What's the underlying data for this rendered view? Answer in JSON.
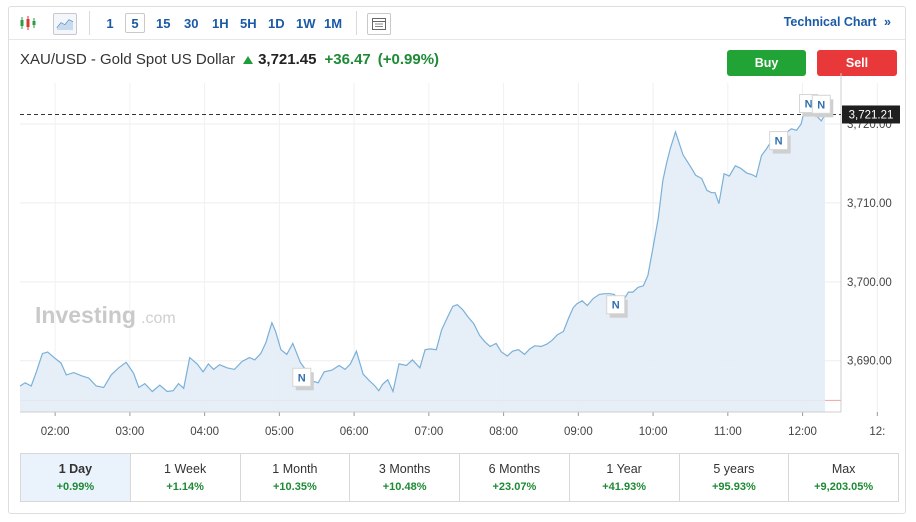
{
  "toolbar": {
    "timeframes": [
      "1",
      "5",
      "15",
      "30",
      "1H",
      "5H",
      "1D",
      "1W",
      "1M"
    ],
    "active_timeframe": "5",
    "technical_chart_label": "Technical Chart",
    "technical_chart_arrow": "»"
  },
  "instrument": {
    "title": "XAU/USD - Gold Spot US Dollar",
    "price": "3,721.45",
    "change": "+36.47",
    "change_pct": "(+0.99%)"
  },
  "actions": {
    "buy_label": "Buy",
    "sell_label": "Sell"
  },
  "watermark": {
    "brand": "Investing",
    "suffix": ".com"
  },
  "colors": {
    "up": "#1e8a35",
    "line": "#7ab0d8",
    "area": "#e3edf6",
    "buy": "#22a335",
    "sell": "#e8383a",
    "link": "#1a5aa6"
  },
  "chart_data": {
    "type": "area",
    "current_price_label": "3,721.21",
    "current_price": 3721.21,
    "previous_close": 3684.98,
    "x_ticks": [
      "02:00",
      "03:00",
      "04:00",
      "05:00",
      "06:00",
      "07:00",
      "08:00",
      "09:00",
      "10:00",
      "11:00",
      "12:00",
      "12:"
    ],
    "y_ticks": [
      "3,690.00",
      "3,700.00",
      "3,710.00",
      "3,720.00"
    ],
    "ylim": [
      3683.5,
      3725.2
    ],
    "xlim": [
      1.53,
      12.3
    ],
    "grid": true,
    "news_marker_label": "N",
    "news_markers": [
      {
        "t": 5.3,
        "y": 3687.9
      },
      {
        "t": 9.5,
        "y": 3697.1
      },
      {
        "t": 11.68,
        "y": 3717.9
      },
      {
        "t": 12.08,
        "y": 3722.6
      },
      {
        "t": 12.25,
        "y": 3722.5
      }
    ],
    "series": [
      {
        "x": [
          1.53,
          1.6,
          1.68,
          1.75,
          1.83,
          1.9,
          2.0,
          2.08,
          2.15,
          2.25,
          2.35,
          2.45,
          2.55,
          2.65,
          2.75,
          2.85,
          2.95,
          3.05,
          3.12,
          3.2,
          3.3,
          3.4,
          3.5,
          3.58,
          3.65,
          3.72,
          3.8,
          3.9,
          3.98,
          4.05,
          4.12,
          4.2,
          4.3,
          4.4,
          4.5,
          4.6,
          4.67,
          4.75,
          4.82,
          4.9,
          4.95,
          5.02,
          5.1,
          5.18,
          5.28,
          5.38,
          5.45,
          5.52,
          5.6,
          5.7,
          5.8,
          5.88,
          5.95,
          6.03,
          6.12,
          6.2,
          6.28,
          6.33,
          6.38,
          6.45,
          6.52,
          6.6,
          6.7,
          6.78,
          6.88,
          6.95,
          7.02,
          7.1,
          7.17,
          7.25,
          7.32,
          7.38,
          7.45,
          7.52,
          7.6,
          7.68,
          7.75,
          7.82,
          7.9,
          7.97,
          8.05,
          8.12,
          8.2,
          8.28,
          8.35,
          8.42,
          8.5,
          8.58,
          8.65,
          8.72,
          8.8,
          8.87,
          8.93,
          8.98,
          9.05,
          9.12,
          9.2,
          9.28,
          9.35,
          9.42,
          9.48,
          9.53,
          9.6,
          9.67,
          9.73,
          9.8,
          9.87,
          9.93,
          10.0,
          10.07,
          10.13,
          10.18,
          10.23,
          10.3,
          10.4,
          10.5,
          10.57,
          10.65,
          10.72,
          10.78,
          10.83,
          10.88,
          10.95,
          11.02,
          11.1,
          11.17,
          11.25,
          11.32,
          11.38,
          11.45,
          11.52,
          11.58,
          11.65,
          11.72,
          11.78,
          11.85,
          11.92,
          11.98,
          12.05,
          12.1,
          12.15,
          12.2,
          12.25,
          12.3
        ],
        "y": [
          3686.8,
          3687.2,
          3686.8,
          3688.6,
          3690.9,
          3691.1,
          3690.3,
          3689.7,
          3688.2,
          3688.5,
          3688.1,
          3687.8,
          3686.8,
          3686.6,
          3688.2,
          3689.1,
          3689.8,
          3688.4,
          3686.6,
          3687.1,
          3686.1,
          3686.9,
          3686.1,
          3686.2,
          3687.1,
          3686.5,
          3690.4,
          3689.6,
          3688.6,
          3689.6,
          3688.9,
          3689.5,
          3689.1,
          3688.9,
          3689.9,
          3690.4,
          3690.1,
          3690.9,
          3692.3,
          3694.8,
          3693.7,
          3691.4,
          3690.8,
          3692.2,
          3689.8,
          3688.5,
          3687.4,
          3687.2,
          3688.6,
          3688.8,
          3689.4,
          3688.9,
          3689.6,
          3691.2,
          3688.3,
          3687.5,
          3686.8,
          3686.2,
          3687.0,
          3687.6,
          3686.1,
          3689.6,
          3689.4,
          3690.1,
          3689.1,
          3691.4,
          3691.5,
          3691.4,
          3693.9,
          3695.5,
          3696.9,
          3697.1,
          3696.5,
          3695.6,
          3694.7,
          3693.2,
          3692.4,
          3691.8,
          3692.2,
          3691.1,
          3690.6,
          3691.2,
          3691.4,
          3690.8,
          3691.5,
          3691.9,
          3691.8,
          3692.1,
          3692.6,
          3693.3,
          3693.7,
          3695.4,
          3696.7,
          3697.2,
          3697.6,
          3697.0,
          3697.9,
          3698.4,
          3698.5,
          3698.5,
          3698.4,
          3697.8,
          3697.6,
          3698.7,
          3698.7,
          3699.3,
          3699.5,
          3700.8,
          3704.4,
          3708.1,
          3712.8,
          3715.0,
          3716.9,
          3719.0,
          3716.1,
          3714.6,
          3713.5,
          3713.1,
          3711.6,
          3711.3,
          3711.3,
          3709.9,
          3713.7,
          3713.4,
          3714.7,
          3714.4,
          3713.8,
          3713.6,
          3713.3,
          3716.0,
          3716.9,
          3717.8,
          3716.9,
          3717.4,
          3718.9,
          3719.4,
          3719.2,
          3720.0,
          3722.7,
          3721.6,
          3722.0,
          3720.9,
          3720.4,
          3721.2
        ]
      }
    ]
  }
}
